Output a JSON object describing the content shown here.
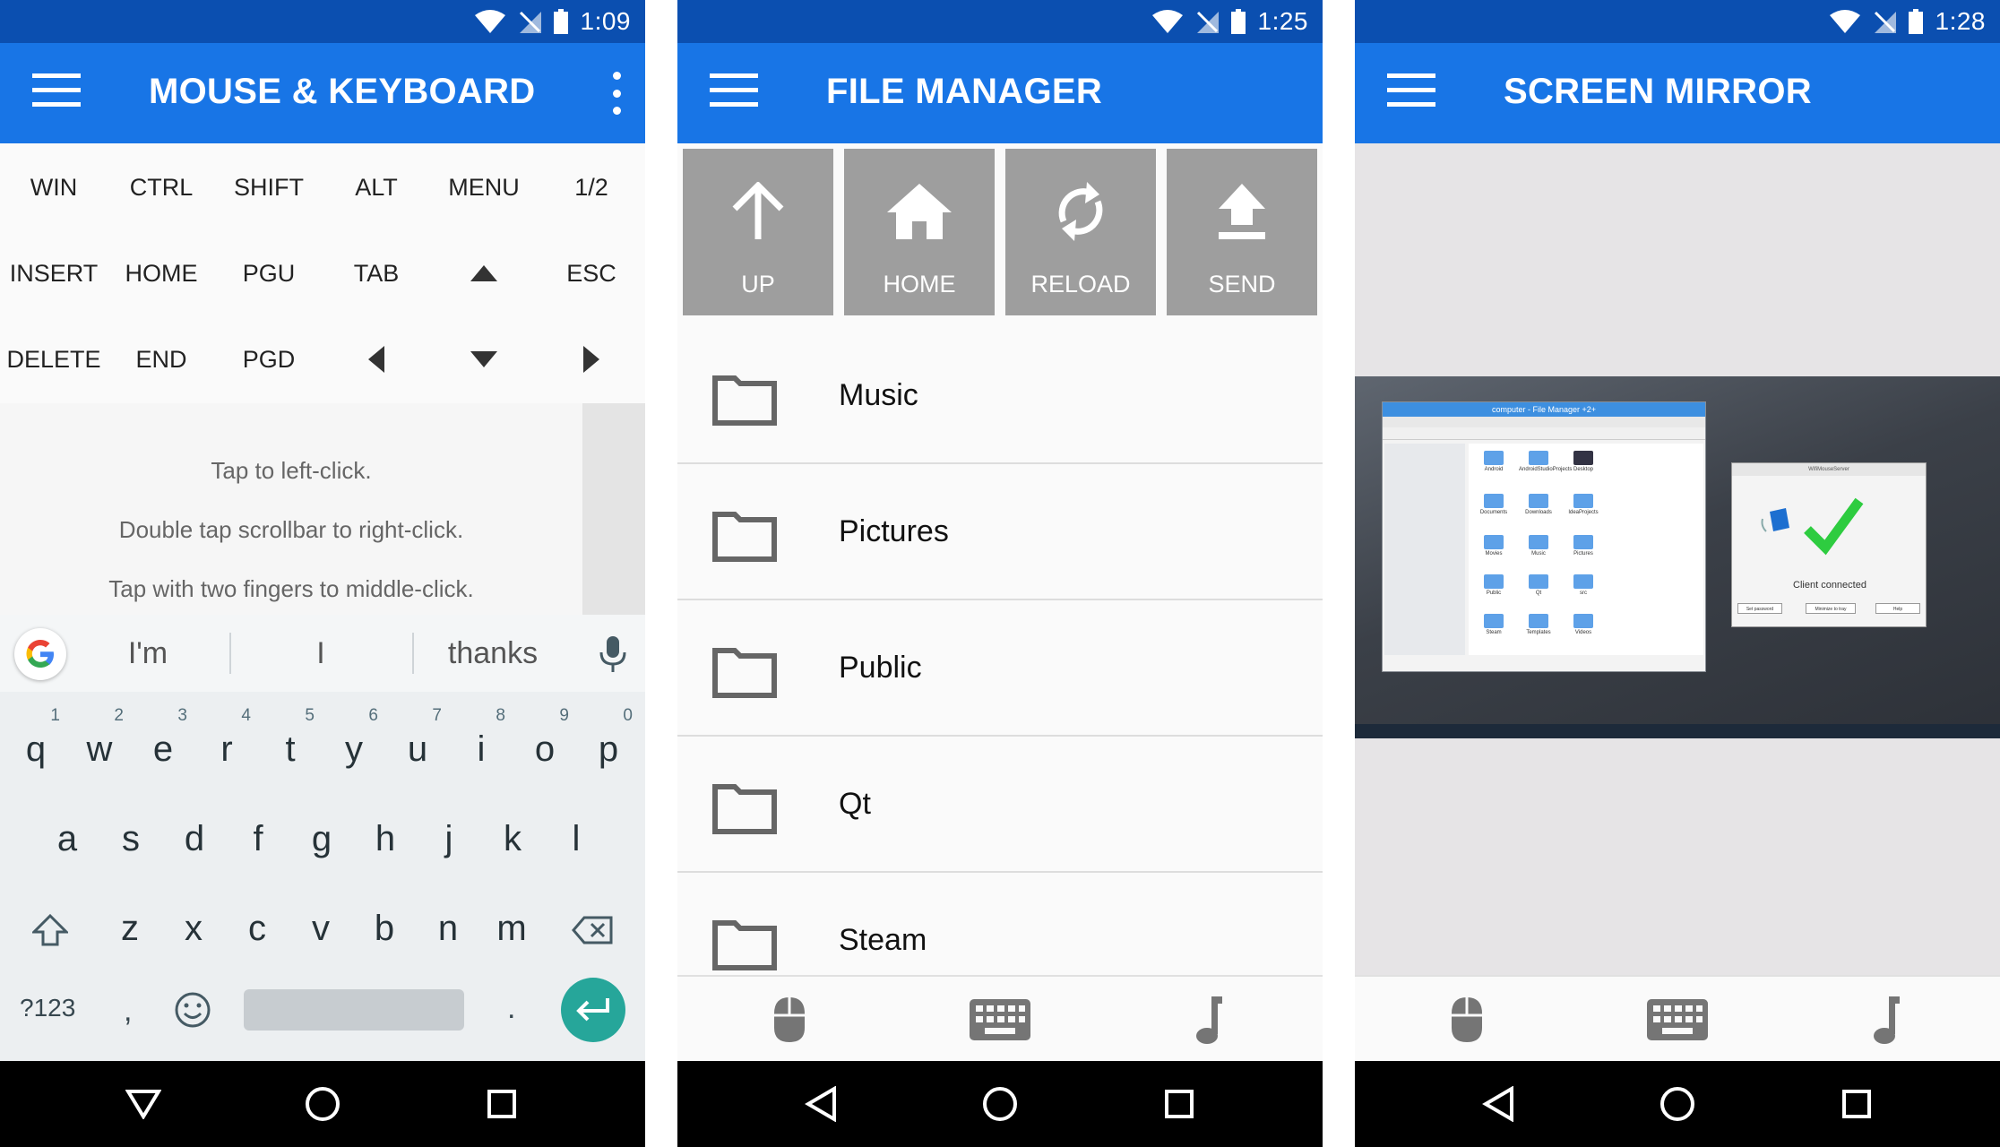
{
  "colors": {
    "status_bar": "#0b4fb0",
    "app_bar": "#1875e6",
    "tool_button": "#9e9e9e",
    "enter_key": "#26a69a"
  },
  "screens": [
    {
      "status_time": "1:09",
      "title": "MOUSE & KEYBOARD",
      "key_rows": [
        [
          "WIN",
          "CTRL",
          "SHIFT",
          "ALT",
          "MENU",
          "1/2"
        ],
        [
          "INSERT",
          "HOME",
          "PGU",
          "TAB",
          "arrow-up-icon",
          "ESC"
        ],
        [
          "DELETE",
          "END",
          "PGD",
          "arrow-left-icon",
          "arrow-down-icon",
          "arrow-right-icon"
        ]
      ],
      "hints": [
        "Tap to left-click.",
        "Double tap scrollbar to right-click.",
        "Tap with two fingers to middle-click."
      ],
      "keyboard": {
        "suggestions": [
          "I'm",
          "I",
          "thanks"
        ],
        "row1": [
          {
            "c": "q",
            "n": "1"
          },
          {
            "c": "w",
            "n": "2"
          },
          {
            "c": "e",
            "n": "3"
          },
          {
            "c": "r",
            "n": "4"
          },
          {
            "c": "t",
            "n": "5"
          },
          {
            "c": "y",
            "n": "6"
          },
          {
            "c": "u",
            "n": "7"
          },
          {
            "c": "i",
            "n": "8"
          },
          {
            "c": "o",
            "n": "9"
          },
          {
            "c": "p",
            "n": "0"
          }
        ],
        "row2": [
          "a",
          "s",
          "d",
          "f",
          "g",
          "h",
          "j",
          "k",
          "l"
        ],
        "row3": [
          "z",
          "x",
          "c",
          "v",
          "b",
          "n",
          "m"
        ],
        "symbols_key": "?123",
        "comma": ",",
        "period": "."
      }
    },
    {
      "status_time": "1:25",
      "title": "FILE MANAGER",
      "tools": [
        {
          "label": "UP",
          "icon": "arrow-up-icon"
        },
        {
          "label": "HOME",
          "icon": "home-icon"
        },
        {
          "label": "RELOAD",
          "icon": "reload-icon"
        },
        {
          "label": "SEND",
          "icon": "upload-icon"
        }
      ],
      "folders": [
        "Music",
        "Pictures",
        "Public",
        "Qt",
        "Steam"
      ]
    },
    {
      "status_time": "1:28",
      "title": "SCREEN MIRROR",
      "mirror": {
        "window_title": "computer - File Manager +2+",
        "files": [
          "Android",
          "AndroidStudioProjects",
          "Desktop",
          "Documents",
          "Downloads",
          "IdeaProjects",
          "Movies",
          "Music",
          "Pictures",
          "Public",
          "Qt",
          "src",
          "Steam",
          "Templates",
          "Videos"
        ],
        "dialog_title": "WifiMouseServer",
        "dialog_status": "Client connected",
        "dialog_buttons": [
          "Set password",
          "Minimize to tray",
          "Help"
        ]
      }
    }
  ]
}
